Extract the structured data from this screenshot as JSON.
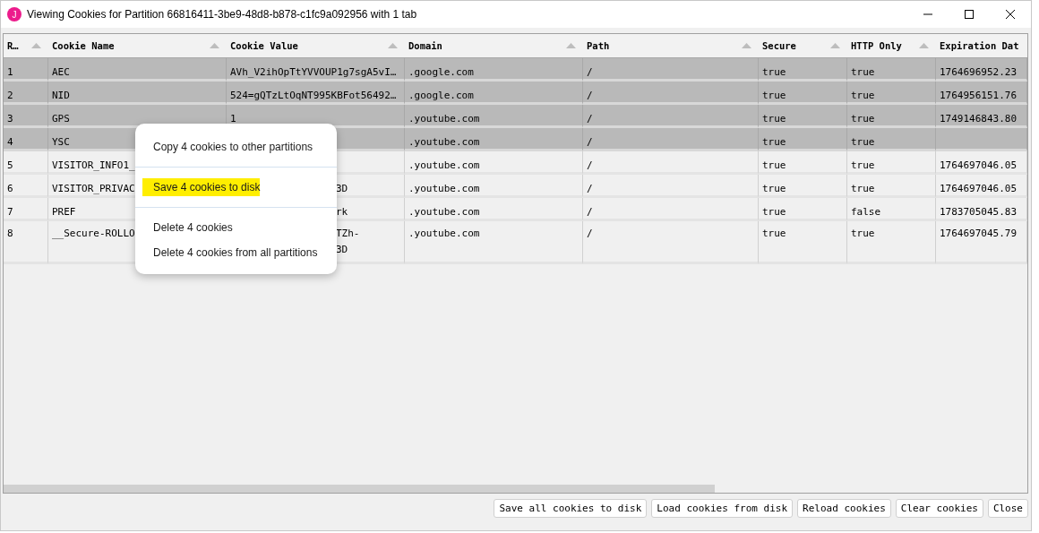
{
  "window": {
    "title": "Viewing Cookies for Partition 66816411-3be9-48d8-b878-c1fc9a092956 with 1 tab",
    "app_icon_letter": "J"
  },
  "table": {
    "columns": [
      {
        "label": "R…",
        "sort": true
      },
      {
        "label": "Cookie Name",
        "sort": true
      },
      {
        "label": "Cookie Value",
        "sort": true
      },
      {
        "label": "Domain",
        "sort": true
      },
      {
        "label": "Path",
        "sort": true
      },
      {
        "label": "Secure",
        "sort": true
      },
      {
        "label": "HTTP Only",
        "sort": true
      },
      {
        "label": "Expiration Dat",
        "sort": false
      }
    ],
    "rows": [
      {
        "selected": true,
        "cells": [
          "1",
          "AEC",
          "AVh_V2ihOpTtYVVOUP1g7sgA5vI…",
          ".google.com",
          "/",
          "true",
          "true",
          "1764696952.23"
        ]
      },
      {
        "selected": true,
        "cells": [
          "2",
          "NID",
          "524=gQTzLtOqNT995KBFot56492…",
          ".google.com",
          "/",
          "true",
          "true",
          "1764956151.76"
        ]
      },
      {
        "selected": true,
        "cells": [
          "3",
          "GPS",
          "1",
          ".youtube.com",
          "/",
          "true",
          "true",
          "1749146843.80"
        ]
      },
      {
        "selected": true,
        "cells": [
          "4",
          "YSC",
          null,
          ".youtube.com",
          "/",
          "true",
          "true",
          ""
        ]
      },
      {
        "selected": false,
        "cells": [
          "5",
          "VISITOR_INFO1_",
          null,
          ".youtube.com",
          "/",
          "true",
          "true",
          "1764697046.05"
        ]
      },
      {
        "selected": false,
        "cells": [
          "6",
          "VISITOR_PRIVAC",
          {
            "covered": "3D"
          },
          ".youtube.com",
          "/",
          "true",
          "true",
          "1764697046.05"
        ]
      },
      {
        "selected": false,
        "cells": [
          "7",
          "PREF",
          {
            "covered": "rk"
          },
          ".youtube.com",
          "/",
          "true",
          "false",
          "1783705045.83"
        ]
      },
      {
        "selected": false,
        "tall": true,
        "cells": [
          "8",
          "__Secure-ROLLO",
          {
            "covered": "TZh-\n3D"
          },
          ".youtube.com",
          "/",
          "true",
          "true",
          "1764697045.79"
        ]
      }
    ]
  },
  "context_menu": {
    "groups": [
      [
        {
          "label": "Copy 4 cookies to other partitions",
          "highlighted": false
        }
      ],
      [
        {
          "label": "Save 4 cookies to disk",
          "highlighted": true
        }
      ],
      [
        {
          "label": "Delete 4 cookies",
          "highlighted": false
        },
        {
          "label": "Delete 4 cookies from all partitions",
          "highlighted": false
        }
      ]
    ]
  },
  "buttons": [
    "Save all cookies to disk",
    "Load cookies from disk",
    "Reload cookies",
    "Clear cookies",
    "Close"
  ]
}
